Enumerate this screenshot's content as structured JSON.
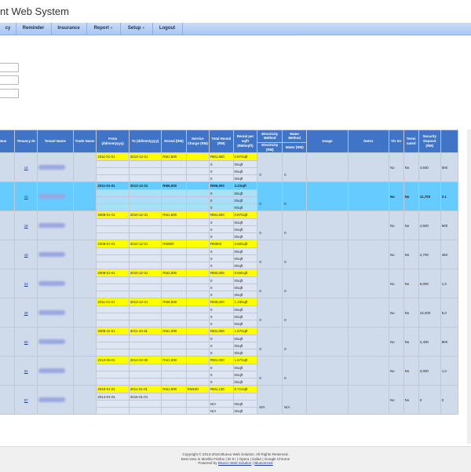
{
  "app": {
    "title": "nt Web System"
  },
  "nav": [
    {
      "label": "cy",
      "caret": false
    },
    {
      "label": "Reminder",
      "caret": false
    },
    {
      "label": "Insurance",
      "caret": false
    },
    {
      "label": "Report",
      "caret": true
    },
    {
      "label": "Setup",
      "caret": true
    },
    {
      "label": "Logout",
      "caret": false
    }
  ],
  "table": {
    "headers": {
      "status": "Status",
      "tenancy_id": "Tenancy ID",
      "tenant_name": "Tenant Name",
      "trade_name": "Trade Name",
      "from": "From (dd/mm/yyyy)",
      "to": "To (dd/mm/yyyy)",
      "rental": "Rental (RM)",
      "service_charge": "Service Charge (RM)",
      "total_rental": "Total Rental (RM)",
      "rental_per_sqft": "Rental per sq/ft (RM/sq/ft)",
      "electricity_method": "Electricity Method",
      "water_method": "Water Method",
      "electricity_rm": "Electricity (RM)",
      "water_rm": "Water (RM)",
      "usage": "Usage",
      "notes": "Notes",
      "viv": "Viv ter",
      "terminated": "Termi nated",
      "security_deposit": "Security Deposit (RM)"
    },
    "rows": [
      {
        "status": "ANT",
        "id": "14",
        "from": "2011-01-01",
        "to": "2013-12-31",
        "rental": "RM1,500",
        "service": "",
        "total": "RM1,500",
        "persqft": "0.97/sqft",
        "zero_persqft": "0/sqft",
        "elec": "0",
        "water": "0",
        "viv": "No",
        "term": "No",
        "deposit": "4,500",
        "extra": "500",
        "active": false,
        "sub": false
      },
      {
        "status": "ANT",
        "id": "16",
        "from": "2011-01-01",
        "to": "2013-12-31",
        "rental": "RM6,000",
        "service": "",
        "total": "RM6,000",
        "persqft": "2.1/sqft",
        "zero_persqft": "0/sqft",
        "elec": "0",
        "water": "0",
        "viv": "No",
        "term": "No",
        "deposit": "11,700",
        "extra": "2.1",
        "active": true,
        "sub": false
      },
      {
        "status": "ANT",
        "id": "18",
        "from": "2008-01-01",
        "to": "2010-12-31",
        "rental": "RM1,500",
        "service": "",
        "total": "RM1,500",
        "persqft": "0.97/sqft",
        "zero_persqft": "0/sqft",
        "elec": "0",
        "water": "0",
        "viv": "No",
        "term": "No",
        "deposit": "4,500",
        "extra": "500",
        "active": false,
        "sub": false
      },
      {
        "status": "ANT",
        "id": "19",
        "from": "2008-01-01",
        "to": "2010-12-31",
        "rental": "RM900",
        "service": "",
        "total": "RM900",
        "persqft": "0.58/sqft",
        "zero_persqft": "0/sqft",
        "elec": "0",
        "water": "0",
        "viv": "No",
        "term": "No",
        "deposit": "2,700",
        "extra": "450",
        "active": false,
        "sub": false
      },
      {
        "status": "ANT",
        "id": "23",
        "from": "2008-01-01",
        "to": "2010-12-31",
        "rental": "RM2,000",
        "service": "",
        "total": "RM2,000",
        "persqft": "0.65/sqft",
        "zero_persqft": "0/sqft",
        "elec": "0",
        "water": "0",
        "viv": "No",
        "term": "No",
        "deposit": "6,000",
        "extra": "1,0",
        "active": false,
        "sub": false
      },
      {
        "status": "ANT",
        "id": "28",
        "from": "2011-01-01",
        "to": "2013-12-31",
        "rental": "RM8,000",
        "service": "",
        "total": "RM8,000",
        "persqft": "1.33/sqft",
        "zero_persqft": "0/sqft",
        "elec": "0",
        "water": "0",
        "viv": "No",
        "term": "No",
        "deposit": "24,000",
        "extra": "6,0",
        "active": false,
        "sub": false
      },
      {
        "status": "ANT",
        "id": "60",
        "from": "2008-11-01",
        "to": "2011-10-31",
        "rental": "RM1,000",
        "service": "",
        "total": "RM1,000",
        "persqft": "1.67/sqft",
        "zero_persqft": "0/sqft",
        "elec": "0",
        "water": "0",
        "viv": "No",
        "term": "No",
        "deposit": "2,400",
        "extra": "800",
        "active": false,
        "sub": false
      },
      {
        "status": "ANT",
        "id": "62",
        "from": "2010-05-01",
        "to": "2012-04-30",
        "rental": "RM1,000",
        "service": "",
        "total": "RM1,000",
        "persqft": "1.67/sqft",
        "zero_persqft": "0/sqft",
        "elec": "0",
        "water": "0",
        "viv": "No",
        "term": "No",
        "deposit": "3,000",
        "extra": "1,0",
        "active": false,
        "sub": false
      },
      {
        "status": "ANT",
        "id": "97",
        "from": "2010-01-01",
        "to": "2011-01-01",
        "rental": "RM1,000",
        "service": "RM100",
        "total": "RM1,100",
        "persqft": "8.71/sqft",
        "zero_persqft": "0/sqft",
        "elec": "N/A",
        "water": "N/A",
        "viv": "No",
        "term": "No",
        "deposit": "0",
        "extra": "0",
        "active": false,
        "sub": true,
        "sub_from": "2014-01-01",
        "sub_to": "2016-01-01"
      }
    ]
  },
  "footer": {
    "line1": "Copyright © 2013-2016 Bluevo Web Solution. All Rights Reserved.",
    "line2": "Best view in Mozilla Firefox | IE 8+ | Opera | Safari | Google Chrome",
    "powered_prefix": "Powered by",
    "link1": "Bluevo Web Solution",
    "sep": "|",
    "link2": "BluevoHost"
  }
}
